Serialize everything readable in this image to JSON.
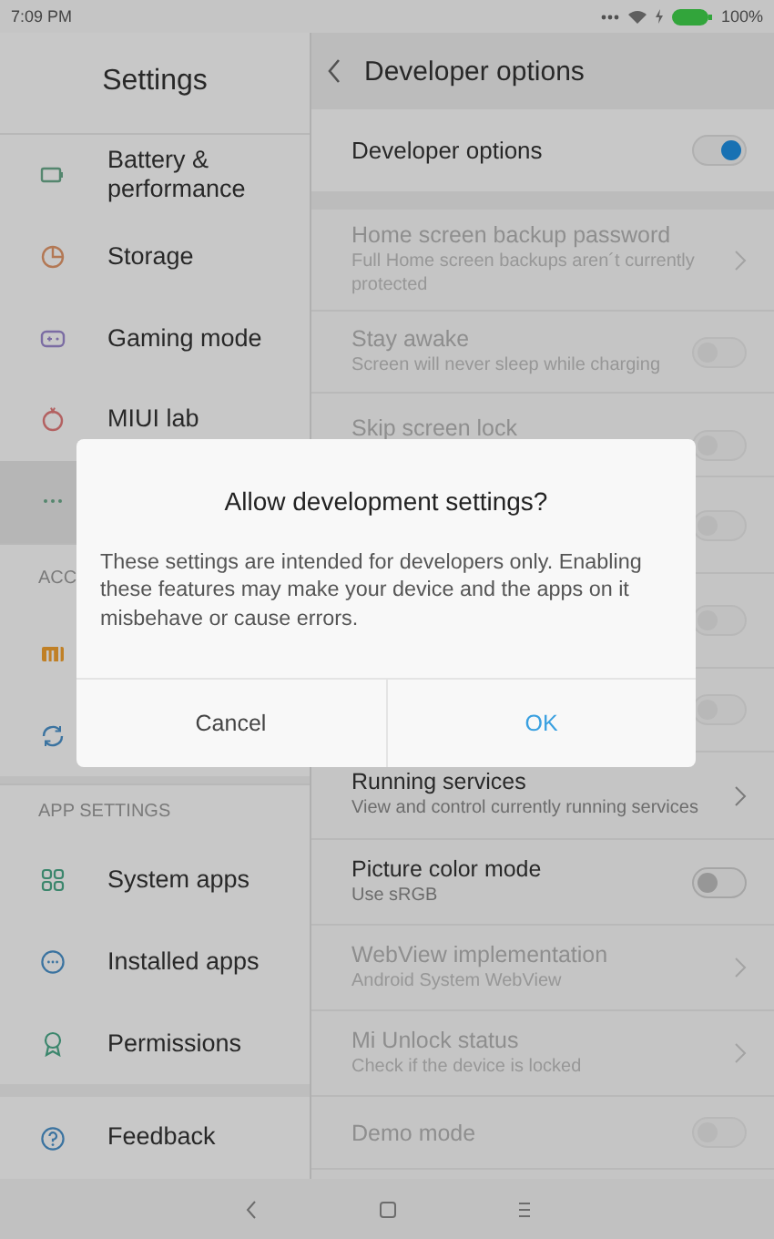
{
  "status_bar": {
    "time": "7:09 PM",
    "battery": "100%"
  },
  "sidebar": {
    "title": "Settings",
    "sections": [
      {
        "items": [
          {
            "label": "Battery & performance",
            "selected": false
          },
          {
            "label": "Storage",
            "selected": false
          },
          {
            "label": "Gaming mode",
            "selected": false
          },
          {
            "label": "MIUI lab",
            "selected": false
          },
          {
            "selected": true
          }
        ]
      },
      {
        "header": "ACC",
        "items": [
          {
            "selected": false
          },
          {
            "selected": false
          }
        ]
      },
      {
        "header": "APP SETTINGS",
        "items": [
          {
            "label": "System apps",
            "selected": false
          },
          {
            "label": "Installed apps",
            "selected": false
          },
          {
            "label": "Permissions",
            "selected": false
          }
        ]
      },
      {
        "items": [
          {
            "label": "Feedback",
            "selected": false
          }
        ]
      }
    ]
  },
  "page": {
    "title": "Developer options",
    "master": {
      "title": "Developer options",
      "on": true
    },
    "rows": [
      {
        "kind": "link",
        "title": "Home screen backup password",
        "subtitle": "Full Home screen backups aren´t currently protected",
        "disabled": true
      },
      {
        "kind": "toggle",
        "title": "Stay awake",
        "subtitle": "Screen will never sleep while charging",
        "disabled": true,
        "on": false
      },
      {
        "kind": "toggle",
        "title": "Skip screen lock",
        "disabled": true,
        "on": false
      },
      {
        "kind": "toggle",
        "disabled": true,
        "on": false
      },
      {
        "kind": "toggle",
        "disabled": true,
        "on": false
      },
      {
        "kind": "toggle",
        "disabled": true,
        "on": false
      },
      {
        "kind": "link",
        "title": "Running services",
        "subtitle": "View and control currently running services",
        "disabled": false
      },
      {
        "kind": "toggle",
        "title": "Picture color mode",
        "subtitle": "Use sRGB",
        "disabled": false,
        "on": false
      },
      {
        "kind": "link",
        "title": "WebView implementation",
        "subtitle": "Android System WebView",
        "disabled": true
      },
      {
        "kind": "link",
        "title": "Mi Unlock status",
        "subtitle": "Check if the device is locked",
        "disabled": true
      },
      {
        "kind": "toggle",
        "title": "Demo mode",
        "disabled": true,
        "on": false
      }
    ]
  },
  "dialog": {
    "title": "Allow development settings?",
    "message": "These settings are intended for developers only. Enabling these features may make your device and the apps on it misbehave or cause errors.",
    "buttons": [
      {
        "label": "Cancel",
        "kind": "neutral"
      },
      {
        "label": "OK",
        "kind": "primary"
      }
    ]
  }
}
